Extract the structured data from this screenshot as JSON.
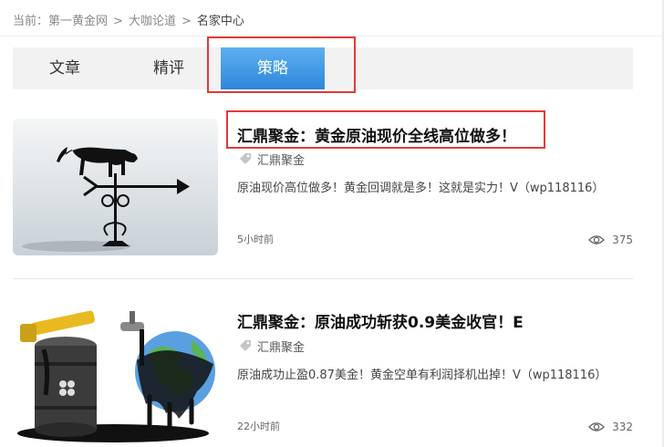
{
  "breadcrumb": {
    "prefix": "当前：",
    "items": [
      "第一黄金网",
      "大咖论道",
      "名家中心"
    ],
    "separator": ">"
  },
  "tabs": [
    {
      "label": "文章",
      "active": false
    },
    {
      "label": "精评",
      "active": false
    },
    {
      "label": "策略",
      "active": true
    }
  ],
  "articles": [
    {
      "title": "汇鼎聚金：黄金原油现价全线高位做多！",
      "tag": "汇鼎聚金",
      "summary": "原油现价高位做多！黄金回调就是多！这就是实力！V（wp118116）",
      "time": "5小时前",
      "views": "375",
      "thumb_icon": "bull-weathervane-image"
    },
    {
      "title": "汇鼎聚金：原油成功斩获0.9美金收官！E",
      "tag": "汇鼎聚金",
      "summary": "原油成功止盈0.87美金！黄金空单有利润择机出掉！V（wp118116）",
      "time": "22小时前",
      "views": "332",
      "thumb_icon": "oil-barrel-globe-image"
    }
  ],
  "colors": {
    "accent": "#2d86db",
    "highlight": "#e53935"
  }
}
